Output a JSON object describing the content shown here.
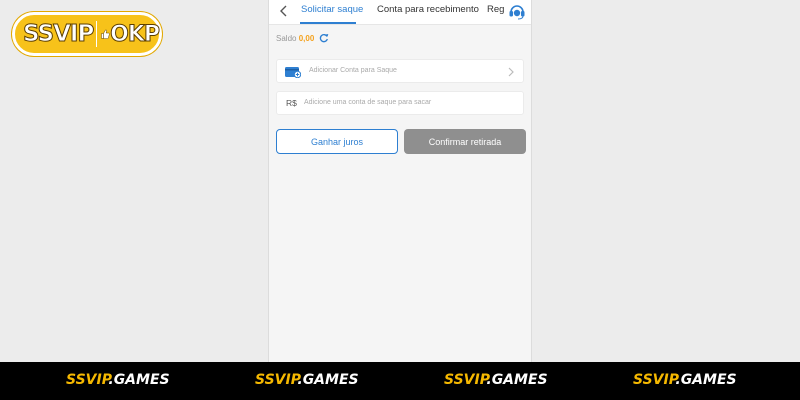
{
  "logo": {
    "part1": "SSVIP",
    "part2": "OKP"
  },
  "header": {
    "tabs": [
      {
        "label": "Solicitar saque",
        "active": true
      },
      {
        "label": "Conta para recebimento",
        "active": false
      },
      {
        "label": "Reg",
        "active": false
      }
    ]
  },
  "balance": {
    "label": "Saldo",
    "value": "0,00"
  },
  "form": {
    "add_account_label": "Adicionar Conta para Saque",
    "currency_symbol": "R$",
    "amount_placeholder": "Adicione uma conta de saque para sacar"
  },
  "buttons": {
    "earn_interest": "Ganhar juros",
    "confirm_withdrawal": "Confirmar retirada"
  },
  "footer": {
    "brand_prefix": "SSVIP",
    "brand_suffix": ".GAMES"
  },
  "colors": {
    "accent": "#2e7fd1",
    "balance": "#f4a21e",
    "brand_yellow": "#f5b800",
    "disabled_button": "#8f8f8f"
  }
}
